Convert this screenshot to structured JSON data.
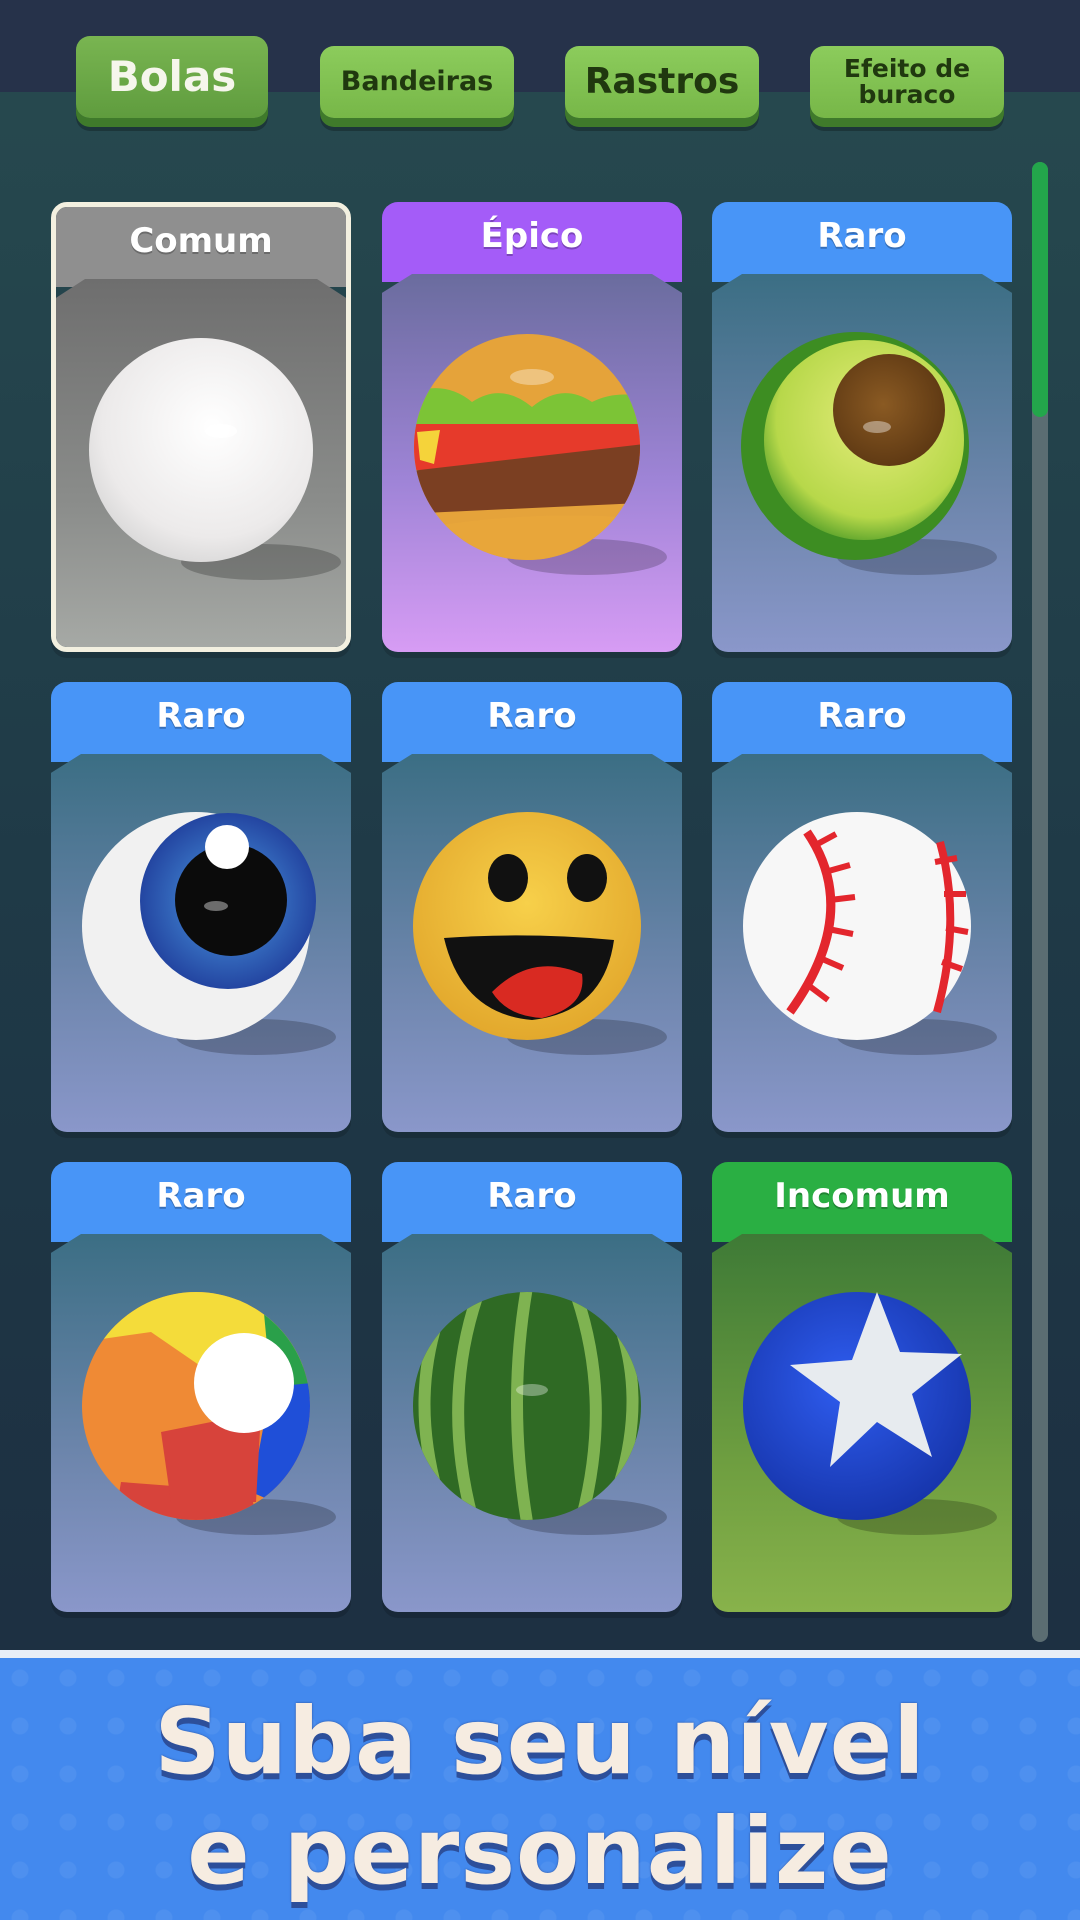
{
  "tabs": [
    {
      "label": "Bolas",
      "active": true
    },
    {
      "label": "Bandeiras",
      "active": false
    },
    {
      "label": "Rastros",
      "active": false
    },
    {
      "label": "Efeito de buraco",
      "active": false
    }
  ],
  "cards": [
    {
      "rarity": "Comum",
      "ball": "white-ball-icon"
    },
    {
      "rarity": "Épico",
      "ball": "burger-ball-icon"
    },
    {
      "rarity": "Raro",
      "ball": "avocado-ball-icon"
    },
    {
      "rarity": "Raro",
      "ball": "eyeball-icon"
    },
    {
      "rarity": "Raro",
      "ball": "smiley-ball-icon"
    },
    {
      "rarity": "Raro",
      "ball": "baseball-icon"
    },
    {
      "rarity": "Raro",
      "ball": "beach-ball-icon"
    },
    {
      "rarity": "Raro",
      "ball": "watermelon-ball-icon"
    },
    {
      "rarity": "Incomum",
      "ball": "star-ball-icon"
    }
  ],
  "banner": {
    "line1": "Suba seu nível",
    "line2": "e personalize"
  },
  "colors": {
    "comum": "#8f8f8f",
    "epico": "#a45cf8",
    "raro": "#4895f7",
    "incomum": "#2aaf43",
    "tab_green": "#7cbd4d",
    "banner_blue": "#4389ee"
  }
}
